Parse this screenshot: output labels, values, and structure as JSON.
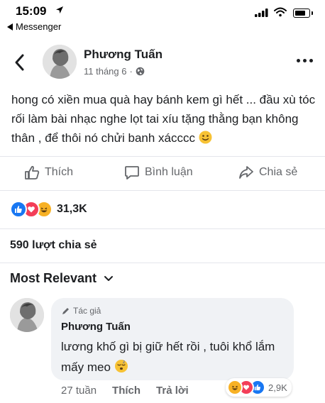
{
  "status_bar": {
    "time": "15:09",
    "back_app": "Messenger"
  },
  "post": {
    "author": "Phương Tuấn",
    "date": "11 tháng 6",
    "separator": "·",
    "text": "hong có xiền mua quà hay bánh kem gì hết ... đầu xù tóc rối làm bài nhạc nghe lọt tai xíu tặng thằng bạn không thân , để thôi nó chửi banh xácccc"
  },
  "actions": {
    "like": "Thích",
    "comment": "Bình luận",
    "share": "Chia sẻ"
  },
  "reactions": {
    "count": "31,3K",
    "types": [
      "like-icon",
      "love-icon",
      "haha-icon"
    ]
  },
  "shares": "590 lượt chia sẻ",
  "comments_sort": "Most Relevant",
  "comment": {
    "badge": "Tác giả",
    "author": "Phương Tuấn",
    "text": "lương khố gì bị giữ hết rồi , tuôi khổ lắm mấy meo",
    "time": "27 tuần",
    "like": "Thích",
    "reply": "Trả lời",
    "reaction_count": "2,9K",
    "reaction_types": [
      "haha-icon",
      "love-icon",
      "like-icon"
    ]
  },
  "colors": {
    "like_blue": "#1877f2",
    "love_red": "#f33e58",
    "haha_yellow": "#f7b125",
    "secondary_text": "#65676b",
    "bubble_bg": "#f0f2f5"
  }
}
